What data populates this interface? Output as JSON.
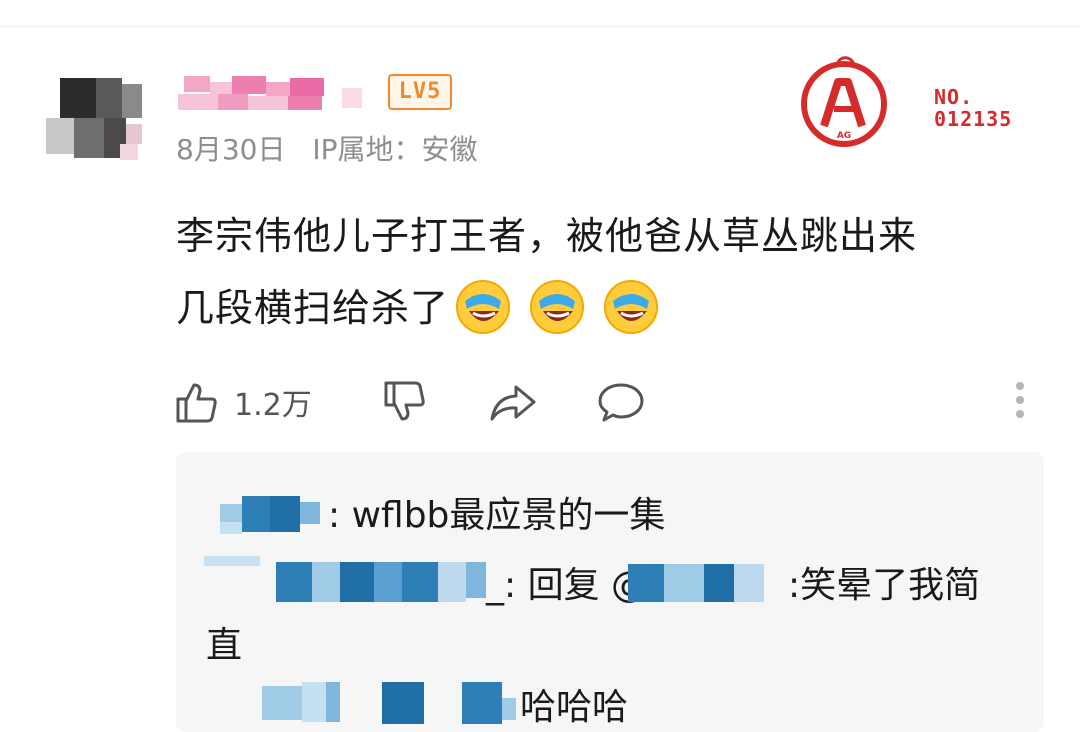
{
  "comment": {
    "level_badge": "LV5",
    "date": "8月30日",
    "ip_location": "IP属地：安徽",
    "text_line1": "李宗伟他儿子打王者，被他爸从草丛跳出来",
    "text_line2": "几段横扫给杀了",
    "emoji_count": 3,
    "emoji_name": "laughing-crying-emoji",
    "like_count": "1.2万"
  },
  "emblem": {
    "number": "NO.\n012135",
    "logo_text": "AG"
  },
  "actions": {
    "like_icon": "thumbs-up-icon",
    "dislike_icon": "thumbs-down-icon",
    "share_icon": "share-icon",
    "reply_icon": "comment-icon",
    "more_icon": "more-vertical-icon"
  },
  "replies": [
    {
      "text": ": wflbb最应景的一集"
    },
    {
      "text": "_: 回复 @",
      "suffix": ":笑晕了我简",
      "wrap": "直"
    },
    {
      "text": "哈哈哈"
    }
  ],
  "colors": {
    "badge": "#f08a2e",
    "emblem_red": "#d62b2b",
    "meta_gray": "#8e8e8e",
    "reply_bg": "#f6f6f6",
    "blur_pink": "#f3a6c6",
    "blur_blue": "#2e7fb6"
  }
}
